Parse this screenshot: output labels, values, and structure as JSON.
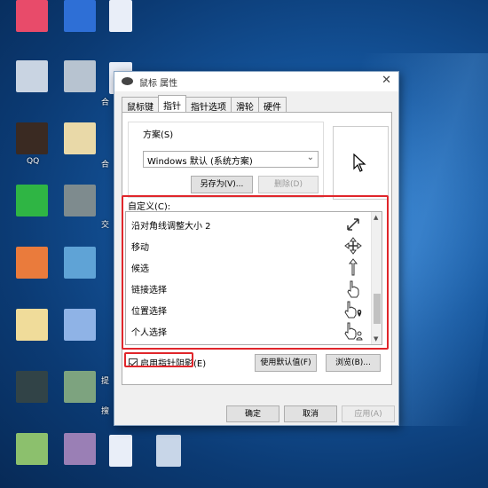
{
  "dialog": {
    "title": "鼠标 属性",
    "close_glyph": "✕"
  },
  "tabs": [
    {
      "label": "鼠标键",
      "active": false
    },
    {
      "label": "指针",
      "active": true
    },
    {
      "label": "指针选项",
      "active": false
    },
    {
      "label": "滑轮",
      "active": false
    },
    {
      "label": "硬件",
      "active": false
    }
  ],
  "scheme": {
    "legend": "方案(S)",
    "selected": "Windows 默认 (系统方案)",
    "save_as_label": "另存为(V)...",
    "delete_label": "删除(D)"
  },
  "customize": {
    "label": "自定义(C):",
    "rows": [
      {
        "name": "沿对角线调整大小 2",
        "icon": "diagonal-resize-2-icon"
      },
      {
        "name": "移动",
        "icon": "move-icon"
      },
      {
        "name": "候选",
        "icon": "alternate-select-icon"
      },
      {
        "name": "链接选择",
        "icon": "link-select-icon"
      },
      {
        "name": "位置选择",
        "icon": "location-select-icon"
      },
      {
        "name": "个人选择",
        "icon": "person-select-icon"
      }
    ]
  },
  "shadow": {
    "label": "启用指针阴影(E)",
    "checked": true
  },
  "use_default_label": "使用默认值(F)",
  "browse_label": "浏览(B)...",
  "footer": {
    "ok_label": "确定",
    "cancel_label": "取消",
    "apply_label": "应用(A)"
  },
  "desktop_labels": {
    "qq": "QQ",
    "he1": "合",
    "he2": "合",
    "jiao": "交",
    "ti": "提",
    "sou": "搜"
  },
  "colors": {
    "highlight": "#e0262b",
    "desktop": "#15569e"
  }
}
